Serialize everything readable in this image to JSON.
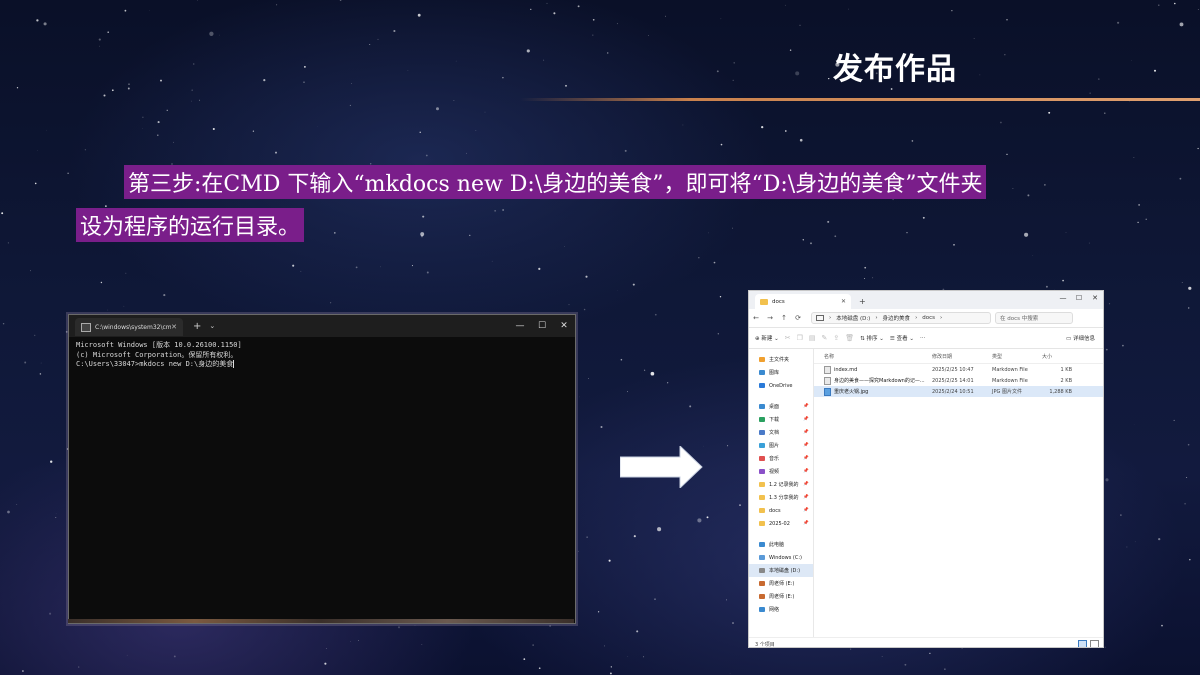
{
  "slide": {
    "title": "发布作品",
    "step_line1": "第三步:在CMD 下输入“mkdocs new D:\\身边的美食”，即可将“D:\\身边的美食”文件夹",
    "step_line2": "设为程序的运行目录。"
  },
  "cmd": {
    "tab_title": "C:\\windows\\system32\\cmd.exe",
    "tab_close": "✕",
    "new_tab": "+",
    "dropdown": "⌄",
    "window_controls": [
      "—",
      "☐",
      "✕"
    ],
    "lines": [
      "Microsoft Windows [版本 10.0.26100.1150]",
      "(c) Microsoft Corporation。保留所有权利。",
      "",
      "C:\\Users\\33047>mkdocs new D:\\身边的美食"
    ]
  },
  "explorer": {
    "tab_title": "docs",
    "new_tab": "+",
    "window_controls": [
      "—",
      "☐",
      "✕"
    ],
    "nav": [
      "←",
      "→",
      "↑",
      "⟳"
    ],
    "address": [
      "本地磁盘 (D:)",
      "身边的美食",
      "docs"
    ],
    "search_placeholder": "在 docs 中搜索",
    "toolbar": {
      "new_label": "新建",
      "sort_label": "排序",
      "view_label": "查看",
      "more": "···",
      "details_label": "详细信息"
    },
    "sidebar": [
      {
        "label": "主文件夹",
        "color": "#f0a030"
      },
      {
        "label": "图库",
        "color": "#3a8ad0"
      },
      {
        "label": "OneDrive",
        "color": "#2a7ad8"
      },
      {
        "label": "",
        "gap": true
      },
      {
        "label": "桌面",
        "color": "#3a8ad0",
        "pinned": true
      },
      {
        "label": "下载",
        "color": "#2aa060",
        "pinned": true
      },
      {
        "label": "文档",
        "color": "#4a7ac8",
        "pinned": true
      },
      {
        "label": "图片",
        "color": "#3aa0d8",
        "pinned": true
      },
      {
        "label": "音乐",
        "color": "#e05050",
        "pinned": true
      },
      {
        "label": "视频",
        "color": "#8a50c8",
        "pinned": true
      },
      {
        "label": "1.2 记录我的",
        "color": "#f2c14e",
        "pinned": true
      },
      {
        "label": "1.3 分享我的",
        "color": "#f2c14e",
        "pinned": true
      },
      {
        "label": "docs",
        "color": "#f2c14e",
        "pinned": true
      },
      {
        "label": "2025-02",
        "color": "#f2c14e",
        "pinned": true
      },
      {
        "label": "",
        "gap": true
      },
      {
        "label": "此电脑",
        "color": "#3a8ad0"
      },
      {
        "label": "Windows (C:)",
        "color": "#5a9ad8"
      },
      {
        "label": "本地磁盘 (D:)",
        "color": "#888888",
        "selected": true
      },
      {
        "label": "周老师 (E:)",
        "color": "#c86a30"
      },
      {
        "label": "周老师 (E:)",
        "color": "#c86a30"
      },
      {
        "label": "网络",
        "color": "#3a8ad0"
      }
    ],
    "columns": [
      "名称",
      "修改日期",
      "类型",
      "大小"
    ],
    "files": [
      {
        "name": "index.md",
        "date": "2025/2/25 10:47",
        "type": "Markdown File",
        "size": "1 KB",
        "icon": "md"
      },
      {
        "name": "身边的美食——探究Markdown的记—...",
        "date": "2025/2/25 14:01",
        "type": "Markdown File",
        "size": "2 KB",
        "icon": "md"
      },
      {
        "name": "重庆老火锅.jpg",
        "date": "2025/2/24 10:51",
        "type": "JPG 图片文件",
        "size": "1,288 KB",
        "icon": "jpg",
        "selected": true
      }
    ],
    "status": "3 个项目"
  }
}
